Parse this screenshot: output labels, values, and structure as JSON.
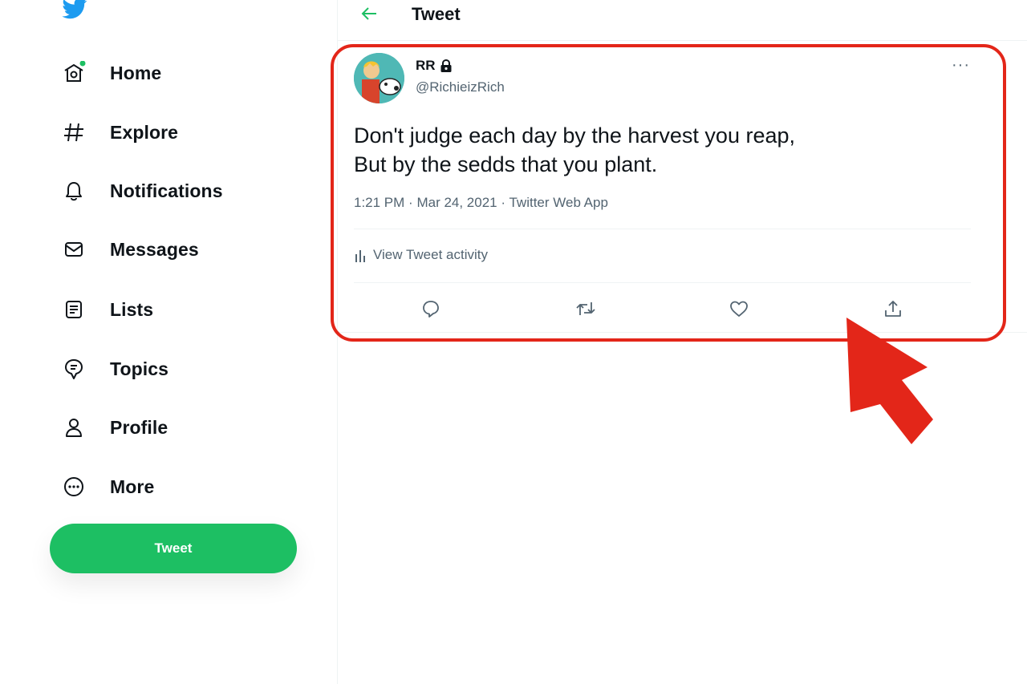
{
  "app": {
    "brand_color": "#1d9bf0",
    "accent_color": "#1dbf63"
  },
  "logo": {
    "icon": "twitter-bird-icon"
  },
  "nav": {
    "items": [
      {
        "label": "Home",
        "icon": "home-icon"
      },
      {
        "label": "Explore",
        "icon": "hashtag-icon"
      },
      {
        "label": "Notifications",
        "icon": "bell-icon"
      },
      {
        "label": "Messages",
        "icon": "envelope-icon"
      },
      {
        "label": "Lists",
        "icon": "list-icon"
      },
      {
        "label": "Topics",
        "icon": "topics-icon"
      },
      {
        "label": "Profile",
        "icon": "person-icon"
      },
      {
        "label": "More",
        "icon": "more-circle-icon"
      }
    ],
    "tweet_button": "Tweet"
  },
  "header": {
    "title": "Tweet",
    "back_icon": "back-arrow-icon"
  },
  "tweet": {
    "author_name": "RR",
    "author_handle": "@RichieizRich",
    "protected_icon": "lock-icon",
    "text_lines": [
      "Don't judge each day by the harvest you reap,",
      "But by the sedds that you plant."
    ],
    "time": "1:21 PM",
    "date": "Mar 24, 2021",
    "separator": "·",
    "source": "Twitter Web App",
    "more_icon": "···",
    "activity_label": "View Tweet activity",
    "actions": [
      "reply-icon",
      "retweet-icon",
      "like-icon",
      "share-icon"
    ]
  },
  "annotation": {
    "highlight_color": "#e32619"
  }
}
